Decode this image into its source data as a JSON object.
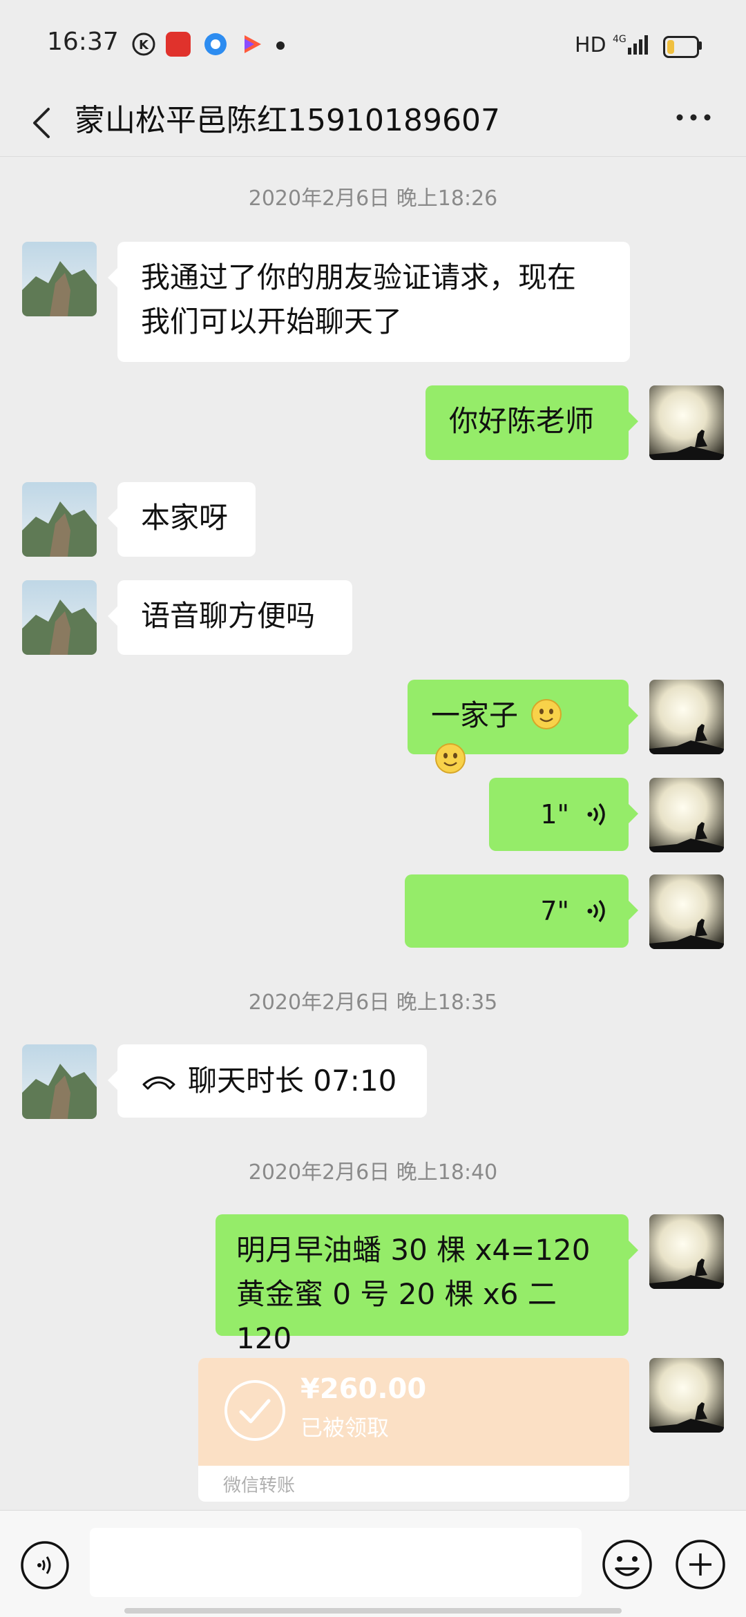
{
  "status_bar": {
    "time": "16:37",
    "network": "HD",
    "signal": "4G"
  },
  "header": {
    "title": "蒙山松平邑陈红15910189607",
    "back_icon": "chevron-left-icon",
    "more_icon": "more-dots-icon"
  },
  "timestamps": [
    "2020年2月6日 晚上18:26",
    "2020年2月6日 晚上18:35",
    "2020年2月6日 晚上18:40"
  ],
  "messages": [
    {
      "side": "left",
      "line1": "我通过了你的朋友验证请求，现在",
      "line2": "我们可以开始聊天了"
    },
    {
      "side": "right",
      "text": "你好陈老师"
    },
    {
      "side": "left",
      "text": "本家呀"
    },
    {
      "side": "left",
      "text": "语音聊方便吗"
    },
    {
      "side": "right",
      "text": "一家子"
    },
    {
      "side": "right",
      "voice_length": "1\""
    },
    {
      "side": "right",
      "voice_length": "7\""
    },
    {
      "side": "left",
      "call_text": "聊天时长 07:10"
    },
    {
      "side": "right",
      "line1": "明月早油蟠 30 棵 x4=120",
      "line2": "黄金蜜 0 号 20 棵 x6 二 120"
    }
  ],
  "transfer": {
    "amount": "¥260.00",
    "status": "已被领取",
    "footer": "微信转账"
  },
  "input_bar": {
    "placeholder": "",
    "voice_icon": "voice-input-icon",
    "emoji_icon": "emoji-icon",
    "plus_icon": "plus-icon"
  },
  "colors": {
    "background": "#ededed",
    "bubble_self": "#95ec69",
    "bubble_other": "#ffffff",
    "transfer": "#fbe0c5"
  }
}
